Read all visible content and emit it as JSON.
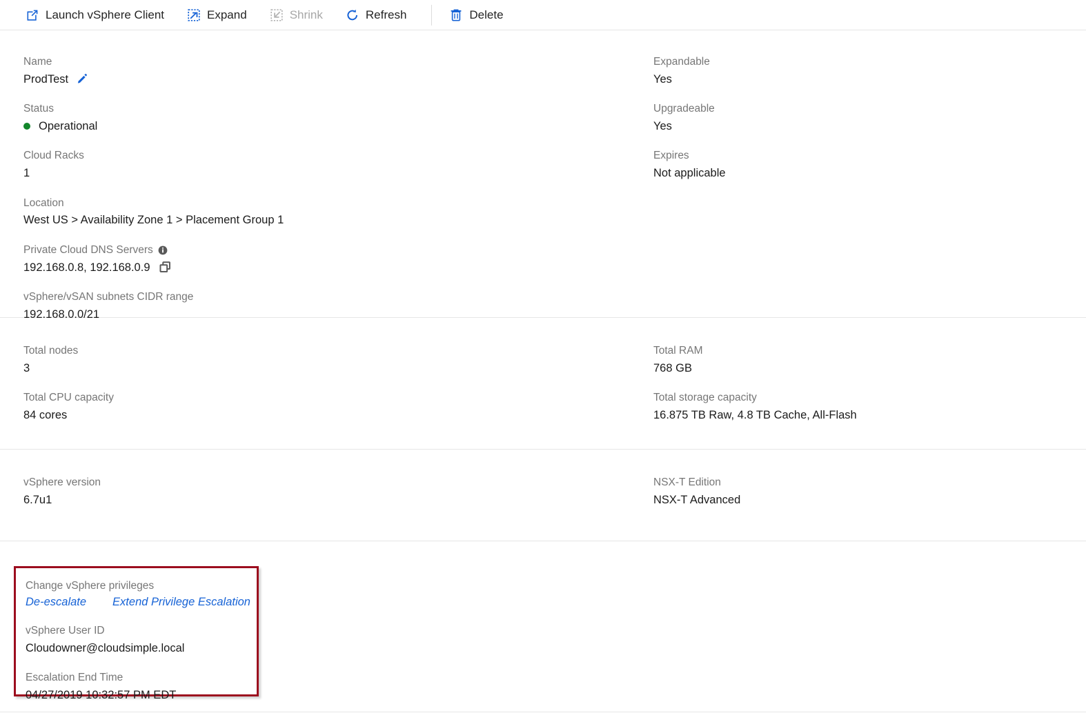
{
  "toolbar": {
    "items": [
      {
        "label": "Launch vSphere Client",
        "icon": "external-link-icon",
        "disabled": false
      },
      {
        "label": "Expand",
        "icon": "expand-icon",
        "disabled": false
      },
      {
        "label": "Shrink",
        "icon": "shrink-icon",
        "disabled": true
      },
      {
        "label": "Refresh",
        "icon": "refresh-icon",
        "disabled": false
      },
      {
        "label": "Delete",
        "icon": "trash-icon",
        "disabled": false
      }
    ]
  },
  "overview": {
    "name_label": "Name",
    "name_value": "ProdTest",
    "status_label": "Status",
    "status_value": "Operational",
    "status_color": "#13862b",
    "cloud_racks_label": "Cloud Racks",
    "cloud_racks_value": "1",
    "location_label": "Location",
    "location_value": "West US > Availability Zone 1 > Placement Group 1",
    "dns_label": "Private Cloud DNS Servers",
    "dns_value": "192.168.0.8, 192.168.0.9",
    "cidr_label": "vSphere/vSAN subnets CIDR range",
    "cidr_value": "192.168.0.0/21",
    "expandable_label": "Expandable",
    "expandable_value": "Yes",
    "upgradeable_label": "Upgradeable",
    "upgradeable_value": "Yes",
    "expires_label": "Expires",
    "expires_value": "Not applicable"
  },
  "capacity": {
    "total_nodes_label": "Total nodes",
    "total_nodes_value": "3",
    "total_cpu_label": "Total CPU capacity",
    "total_cpu_value": "84 cores",
    "total_ram_label": "Total RAM",
    "total_ram_value": "768 GB",
    "total_storage_label": "Total storage capacity",
    "total_storage_value": "16.875 TB Raw, 4.8 TB Cache, All-Flash"
  },
  "software": {
    "vsphere_version_label": "vSphere version",
    "vsphere_version_value": "6.7u1",
    "nsxt_edition_label": "NSX-T Edition",
    "nsxt_edition_value": "NSX-T Advanced"
  },
  "privileges": {
    "change_label": "Change vSphere privileges",
    "deescalate_link": "De-escalate",
    "extend_link": "Extend Privilege Escalation",
    "user_id_label": "vSphere User ID",
    "user_id_value": "Cloudowner@cloudsimple.local",
    "end_time_label": "Escalation End Time",
    "end_time_value": "04/27/2019 10:32:57 PM EDT",
    "highlight_color": "#9c0d1e",
    "link_color": "#1763d6"
  }
}
